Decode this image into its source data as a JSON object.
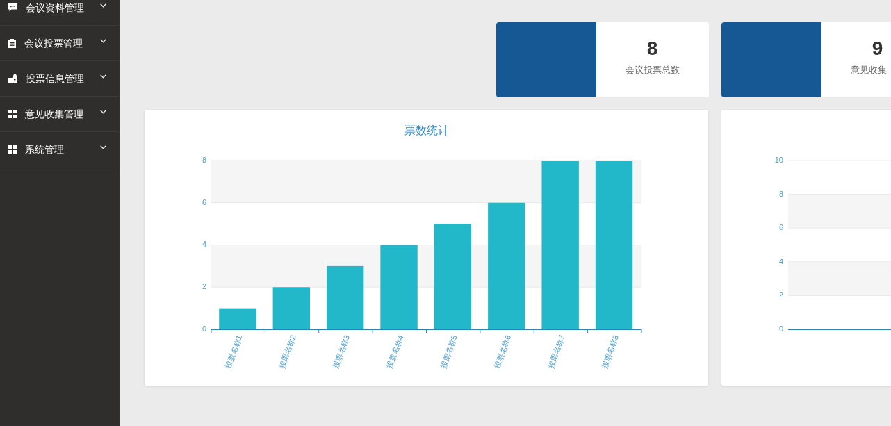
{
  "sidebar": {
    "items": [
      {
        "label": "会议资料管理",
        "expanded": false
      },
      {
        "label": "会议投票管理",
        "expanded": false
      },
      {
        "label": "投票信息管理",
        "expanded": false
      },
      {
        "label": "意见收集管理",
        "expanded": false
      },
      {
        "label": "系统管理",
        "expanded": false
      }
    ]
  },
  "stats": [
    {
      "value": "8",
      "label": "会议投票总数"
    },
    {
      "value": "9",
      "label": "意见收集"
    }
  ],
  "charts": [
    {
      "chart_data": {
        "type": "bar",
        "title": "票数统计",
        "categories": [
          "投票名称1",
          "投票名称2",
          "投票名称3",
          "投票名称4",
          "投票名称5",
          "投票名称6",
          "投票名称7",
          "投票名称8"
        ],
        "values": [
          1,
          2,
          3,
          4,
          5,
          6,
          8,
          8
        ],
        "ylim": [
          0,
          8
        ],
        "yticks": [
          0,
          2,
          4,
          6,
          8
        ],
        "grid": true
      }
    },
    {
      "empty_axes": {
        "y_labels": [
          "10",
          "8",
          "6",
          "4",
          "2",
          "0"
        ]
      }
    }
  ]
}
